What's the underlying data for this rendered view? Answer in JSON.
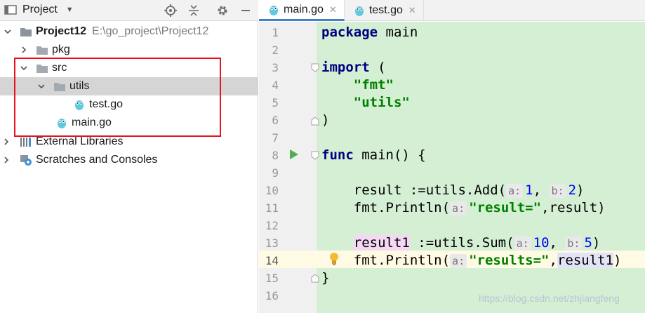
{
  "project_panel": {
    "title": "Project",
    "header_icons": [
      "crosshair-icon",
      "collapse-icon",
      "gear-icon",
      "minimize-icon"
    ]
  },
  "tree": [
    {
      "id": "project12",
      "label": "Project12",
      "path": "E:\\go_project\\Project12",
      "expanded": true,
      "icon": "project-folder-icon"
    },
    {
      "id": "pkg",
      "label": "pkg",
      "expanded": false,
      "icon": "folder-icon"
    },
    {
      "id": "src",
      "label": "src",
      "expanded": true,
      "icon": "folder-icon"
    },
    {
      "id": "utils",
      "label": "utils",
      "expanded": true,
      "icon": "folder-icon",
      "selected": true
    },
    {
      "id": "test-go",
      "label": "test.go",
      "icon": "go-file-icon"
    },
    {
      "id": "main-go",
      "label": "main.go",
      "icon": "go-file-icon"
    },
    {
      "id": "external-libraries",
      "label": "External Libraries",
      "expanded": false,
      "icon": "library-icon"
    },
    {
      "id": "scratches",
      "label": "Scratches and Consoles",
      "expanded": false,
      "icon": "scratches-icon"
    }
  ],
  "tabs": [
    {
      "label": "main.go",
      "active": true
    },
    {
      "label": "test.go",
      "active": false
    }
  ],
  "code": {
    "line_numbers": [
      "1",
      "2",
      "3",
      "4",
      "5",
      "6",
      "7",
      "8",
      "9",
      "10",
      "11",
      "12",
      "13",
      "14",
      "15",
      "16"
    ],
    "current_line": "14",
    "l1": {
      "kw": "package",
      "rest": " main"
    },
    "l3": {
      "kw": "import",
      "rest": " ("
    },
    "l4": {
      "str": "\"fmt\""
    },
    "l5": {
      "str": "\"utils\""
    },
    "l6": {
      "rest": ")"
    },
    "l8": {
      "kw": "func",
      "rest": " main() {"
    },
    "l10": {
      "pre": "result :=utils.Add(",
      "hint_a": "a:",
      "arg_a": "1",
      "sep": ", ",
      "hint_b": "b:",
      "arg_b": "2",
      "post": ")"
    },
    "l11": {
      "pre": "fmt.Println(",
      "hint_a": "a:",
      "str": "\"result=\"",
      "post": ",result)"
    },
    "l13": {
      "var": "result1",
      "pre": " :=utils.Sum(",
      "hint_a": "a:",
      "arg_a": "10",
      "sep": ", ",
      "hint_b": "b:",
      "arg_b": "5",
      "post": ")"
    },
    "l14": {
      "pre": "fmt.Println(",
      "hint_a": "a:",
      "str": "\"results=\"",
      "sep": ",",
      "var": "result1",
      "post": ")"
    },
    "l15": {
      "rest": "}"
    }
  },
  "watermark": "https://blog.csdn.net/zhjiangfeng",
  "colors": {
    "code_background": "#d4efd4",
    "keyword": "#000080",
    "string": "#008000",
    "number": "#0000ff",
    "selection_box": "#e8121c"
  }
}
